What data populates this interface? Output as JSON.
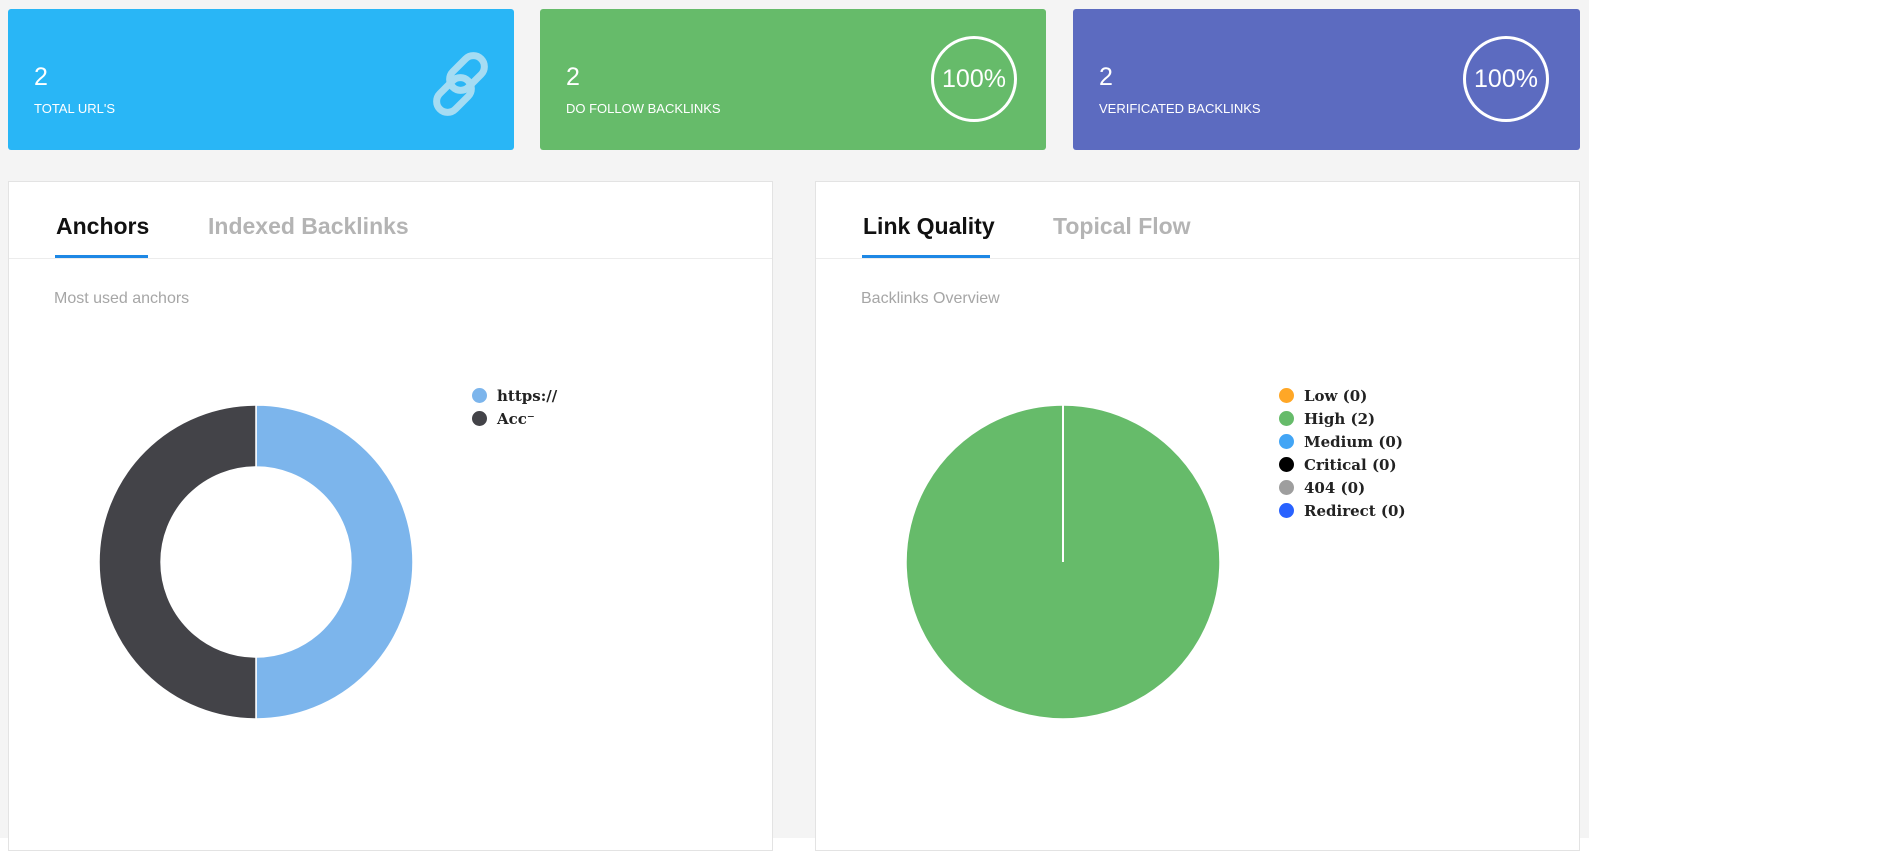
{
  "stats": [
    {
      "value": "2",
      "label": "TOTAL URL'S",
      "color": "#29b6f6",
      "icon": "link-icon"
    },
    {
      "value": "2",
      "label": "DO FOLLOW BACKLINKS",
      "color": "#66bb6a",
      "ring": "100%"
    },
    {
      "value": "2",
      "label": "VERIFICATED BACKLINKS",
      "color": "#5c6bc0",
      "ring": "100%"
    }
  ],
  "left_panel": {
    "tabs": [
      {
        "label": "Anchors"
      },
      {
        "label": "Indexed Backlinks"
      }
    ],
    "subtitle": "Most used anchors"
  },
  "right_panel": {
    "tabs": [
      {
        "label": "Link Quality"
      },
      {
        "label": "Topical Flow"
      }
    ],
    "subtitle": "Backlinks Overview"
  },
  "accent_color": "#1e88e5",
  "chart_data": [
    {
      "type": "pie",
      "subtype": "donut",
      "title": "Most used anchors",
      "series": [
        {
          "name": "https://",
          "value": 1,
          "color": "#7cb5ec"
        },
        {
          "name": "Acc⁻",
          "value": 1,
          "color": "#434348"
        }
      ],
      "legend_position": "right"
    },
    {
      "type": "pie",
      "title": "Backlinks Overview",
      "series": [
        {
          "name": "Low (0)",
          "value": 0,
          "color": "#ffa726"
        },
        {
          "name": "High (2)",
          "value": 2,
          "color": "#66bb6a"
        },
        {
          "name": "Medium (0)",
          "value": 0,
          "color": "#42a5f5"
        },
        {
          "name": "Critical (0)",
          "value": 0,
          "color": "#000000"
        },
        {
          "name": "404 (0)",
          "value": 0,
          "color": "#9e9e9e"
        },
        {
          "name": "Redirect (0)",
          "value": 0,
          "color": "#2962ff"
        }
      ],
      "legend_position": "right"
    }
  ]
}
